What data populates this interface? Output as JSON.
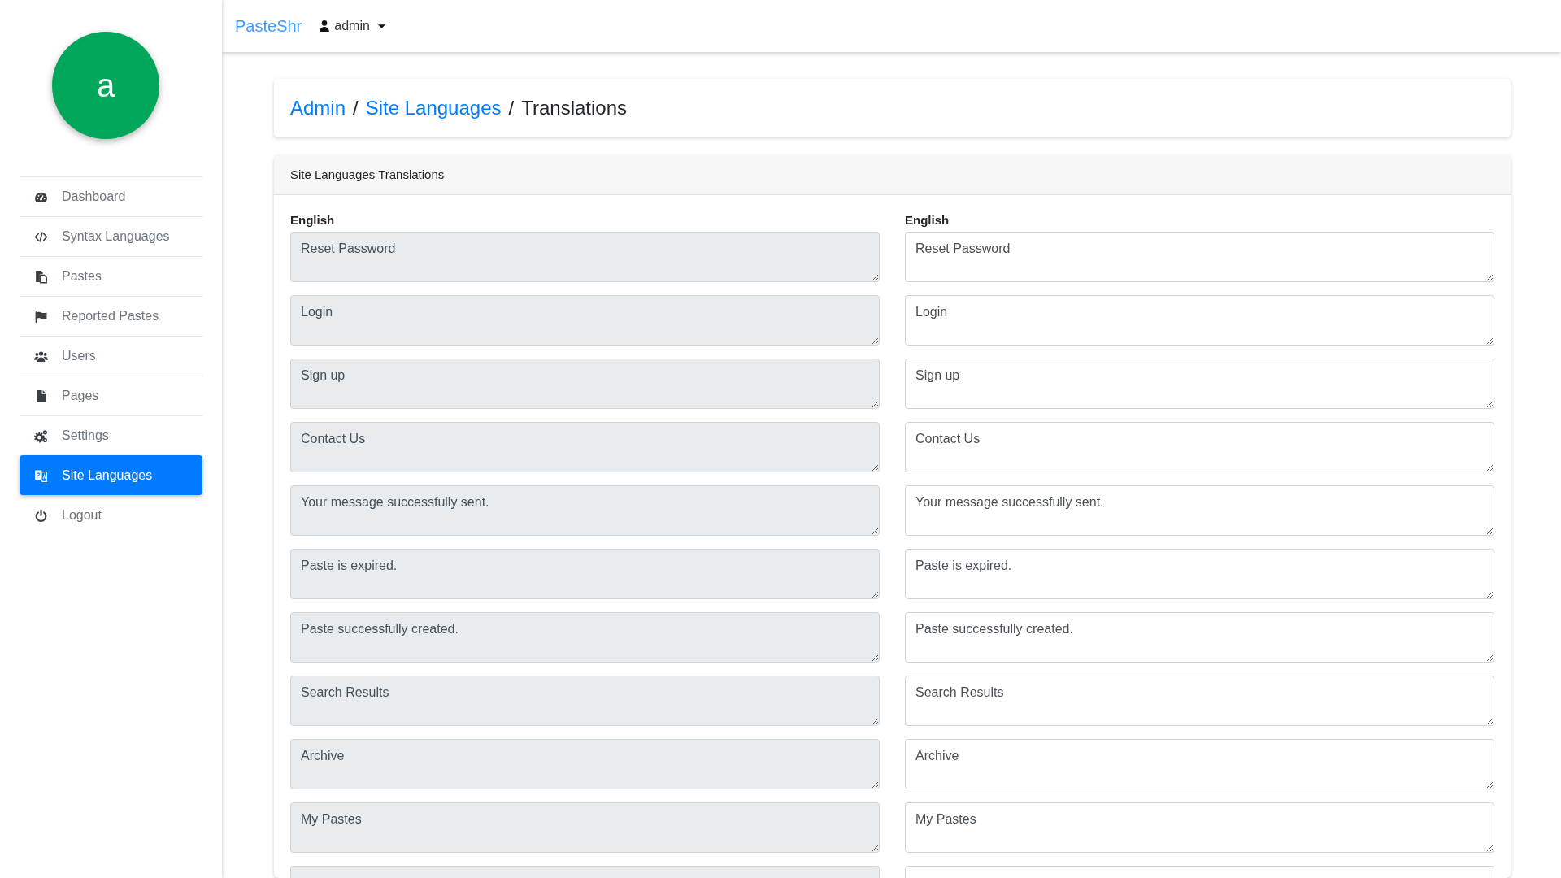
{
  "sidebar": {
    "avatar": {
      "initial": "a"
    },
    "items": [
      {
        "label": "Dashboard",
        "selected": false
      },
      {
        "label": "Syntax Languages",
        "selected": false
      },
      {
        "label": "Pastes",
        "selected": false
      },
      {
        "label": "Reported Pastes",
        "selected": false
      },
      {
        "label": "Users",
        "selected": false
      },
      {
        "label": "Pages",
        "selected": false
      },
      {
        "label": "Settings",
        "selected": false
      },
      {
        "label": "Site Languages",
        "selected": true
      },
      {
        "label": "Logout",
        "selected": false
      }
    ]
  },
  "topbar": {
    "brand": "PasteShr",
    "user_menu": "admin"
  },
  "breadcrumb": [
    {
      "kind": "link",
      "text": "Admin"
    },
    {
      "kind": "separator",
      "text": "/"
    },
    {
      "kind": "link",
      "text": "Site Languages"
    },
    {
      "kind": "separator",
      "text": "/"
    },
    {
      "kind": "current",
      "text": "Translations"
    }
  ],
  "translations_card": {
    "title": "Site Languages Translations",
    "columns": [
      {
        "label": "English",
        "kind": "source"
      },
      {
        "label": "English",
        "kind": "translation"
      }
    ],
    "rows": [
      {
        "values": [
          "Reset Password",
          "Reset Password"
        ]
      },
      {
        "values": [
          "Login",
          "Login"
        ]
      },
      {
        "values": [
          "Sign up",
          "Sign up"
        ]
      },
      {
        "values": [
          "Contact Us",
          "Contact Us"
        ]
      },
      {
        "values": [
          "Your message successfully sent.",
          "Your message successfully sent."
        ]
      },
      {
        "values": [
          "Paste is expired.",
          "Paste is expired."
        ]
      },
      {
        "values": [
          "Paste successfully created.",
          "Paste successfully created."
        ]
      },
      {
        "values": [
          "Search Results",
          "Search Results"
        ]
      },
      {
        "values": [
          "Archive",
          "Archive"
        ]
      },
      {
        "values": [
          "My Pastes",
          "My Pastes"
        ]
      }
    ],
    "more_rows_below": true
  }
}
